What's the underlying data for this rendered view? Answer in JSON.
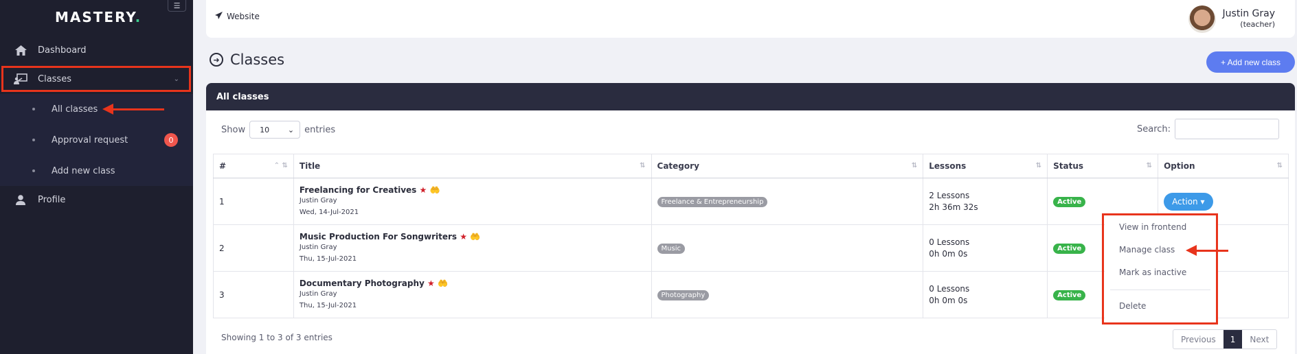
{
  "app": {
    "logo_text": "MASTERY",
    "logo_dot": ".",
    "accent_color": "#5d7cf0"
  },
  "sidebar": {
    "toggle_icon": "menu-icon",
    "items": [
      {
        "label": "Dashboard",
        "icon": "home-icon"
      },
      {
        "label": "Classes",
        "icon": "classroom-icon"
      },
      {
        "label": "Profile",
        "icon": "user-icon"
      }
    ],
    "classes_submenu": [
      {
        "label": "All classes"
      },
      {
        "label": "Approval request",
        "badge": "0"
      },
      {
        "label": "Add new class"
      }
    ]
  },
  "topbar": {
    "website_label": "Website",
    "user_name": "Justin Gray",
    "user_role": "(teacher)"
  },
  "page": {
    "title": "Classes",
    "add_button": "+ Add new class"
  },
  "card": {
    "header": "All classes",
    "show_label": "Show",
    "entries_label": "entries",
    "page_size": "10",
    "search_label": "Search:",
    "columns": [
      "#",
      "Title",
      "Category",
      "Lessons",
      "Status",
      "Option"
    ],
    "rows": [
      {
        "num": "1",
        "title": "Freelancing for Creatives",
        "star": "★",
        "author": "Justin Gray",
        "date": "Wed, 14-Jul-2021",
        "category": "Freelance & Entrepreneurship",
        "lessons": "2 Lessons",
        "duration": "2h 36m 32s",
        "status": "Active"
      },
      {
        "num": "2",
        "title": "Music Production For Songwriters",
        "star": "★",
        "author": "Justin Gray",
        "date": "Thu, 15-Jul-2021",
        "category": "Music",
        "lessons": "0 Lessons",
        "duration": "0h 0m 0s",
        "status": "Active"
      },
      {
        "num": "3",
        "title": "Documentary Photography",
        "star": "★",
        "author": "Justin Gray",
        "date": "Thu, 15-Jul-2021",
        "category": "Photography",
        "lessons": "0 Lessons",
        "duration": "0h 0m 0s",
        "status": "Active"
      }
    ],
    "action_label": "Action",
    "dropdown": {
      "view": "View in frontend",
      "manage": "Manage class",
      "inactive": "Mark as inactive",
      "delete": "Delete"
    },
    "showing": "Showing 1 to 3 of 3 entries",
    "pagination": {
      "prev": "Previous",
      "current": "1",
      "next": "Next"
    }
  }
}
